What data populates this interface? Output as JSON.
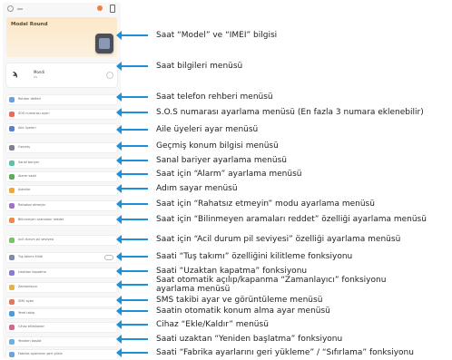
{
  "phone": {
    "model_title": "Model Round",
    "info_card_name": "Mondi",
    "info_card_sub": "0s",
    "menu_items": [
      {
        "text": "Rehber defteri",
        "color": "#6aa0e0"
      },
      {
        "text": "SOS numarası ayarı",
        "color": "#e86b5a"
      },
      {
        "text": "Aile üyeleri",
        "color": "#5a80c8"
      },
      {
        "text": "Geçmiş",
        "color": "#7f7f95"
      },
      {
        "text": "Sanal bariyer",
        "color": "#5ac2a9"
      },
      {
        "text": "Alarm saati",
        "color": "#5cae58"
      },
      {
        "text": "Adımlar",
        "color": "#f0a73c"
      },
      {
        "text": "Rahatsız etmeyin",
        "color": "#9c74c8"
      },
      {
        "text": "Bilinmeyen aramaları reddet",
        "color": "#ef8a4c"
      },
      {
        "text": "Acil durum pil seviyesi",
        "color": "#7cc06a"
      },
      {
        "text": "Tuş takımı kilidi",
        "color": "#7b8ca8"
      },
      {
        "text": "Uzaktan kapatma",
        "color": "#8a7ad0"
      },
      {
        "text": "Zamanlayıcı",
        "color": "#e5b34a"
      },
      {
        "text": "SMS ayarı",
        "color": "#e07a5a"
      },
      {
        "text": "Yerel takip",
        "color": "#4a9ae0"
      },
      {
        "text": "Cihaz ekle/kaldır",
        "color": "#d06a8a"
      },
      {
        "text": "Yeniden başlat",
        "color": "#6ab0e0"
      },
      {
        "text": "Fabrika ayarlarını geri yükle",
        "color": "#6fa3d8"
      }
    ]
  },
  "labels": [
    "Saat “Model” ve “IMEI” bilgisi",
    "Saat bilgileri menüsü",
    "Saat telefon rehberi menüsü",
    "S.O.S numarası ayarlama menüsü (En fazla 3 numara eklenebilir)",
    "Aile üyeleri ayar menüsü",
    "Geçmiş konum bilgisi menüsü",
    "Sanal bariyer ayarlama menüsü",
    "Saat için “Alarm” ayarlama menüsü",
    "Adım sayar menüsü",
    "Saat için “Rahatsız etmeyin” modu ayarlama menüsü",
    "Saat için “Bilinmeyen aramaları reddet” özelliği ayarlama menüsü",
    "Saat için “Acil durum pil seviyesi” özelliği ayarlama menüsü",
    "Saati “Tuş takımı” özelliğini kilitleme fonksiyonu",
    "Saati “Uzaktan kapatma” fonksiyonu",
    "Saat otomatik açılıp/kapanma “Zamanlayıcı” fonksiyonu",
    "ayarlama menüsü",
    "SMS takibi ayar ve görüntüleme menüsü",
    "Saatin otomatik konum alma ayar menüsü",
    "Cihaz “Ekle/Kaldır” menüsü",
    "Saati uzaktan “Yeniden başlatma” fonksiyonu",
    "Saati “Fabrika ayarlarını geri yükleme” / “Sıfırlama” fonksiyonu"
  ],
  "colors": {
    "accent": "#1e8fd9",
    "card": "#fde7c7"
  }
}
